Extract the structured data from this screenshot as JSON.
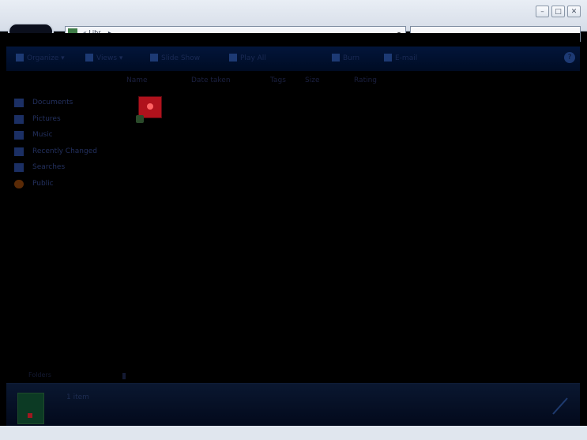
{
  "window": {
    "controls": {
      "minimize_icon": "–",
      "maximize_icon": "□",
      "close_icon": "✕"
    }
  },
  "address_bar": {
    "path": "« Libr... ▸ ...",
    "dropdown_icon": "▾"
  },
  "search": {
    "placeholder": ""
  },
  "toolbar": {
    "items": [
      {
        "label": "Organize ▾"
      },
      {
        "label": "Views ▾"
      },
      {
        "label": "Slide Show"
      },
      {
        "label": "Play All"
      },
      {
        "label": "Burn"
      },
      {
        "label": "E-mail"
      }
    ],
    "help_icon": "?"
  },
  "columns": [
    {
      "label": "Name"
    },
    {
      "label": "Date taken"
    },
    {
      "label": "Tags"
    },
    {
      "label": "Size"
    },
    {
      "label": "Rating"
    }
  ],
  "sidebar": {
    "items": [
      {
        "label": "Documents"
      },
      {
        "label": "Pictures"
      },
      {
        "label": "Music"
      },
      {
        "label": "Recently Changed"
      },
      {
        "label": "Searches"
      },
      {
        "label": "Public"
      }
    ]
  },
  "content": {
    "empty_message": ""
  },
  "status": {
    "label": "Folders",
    "separator": "^"
  },
  "details": {
    "name": "1 item"
  }
}
